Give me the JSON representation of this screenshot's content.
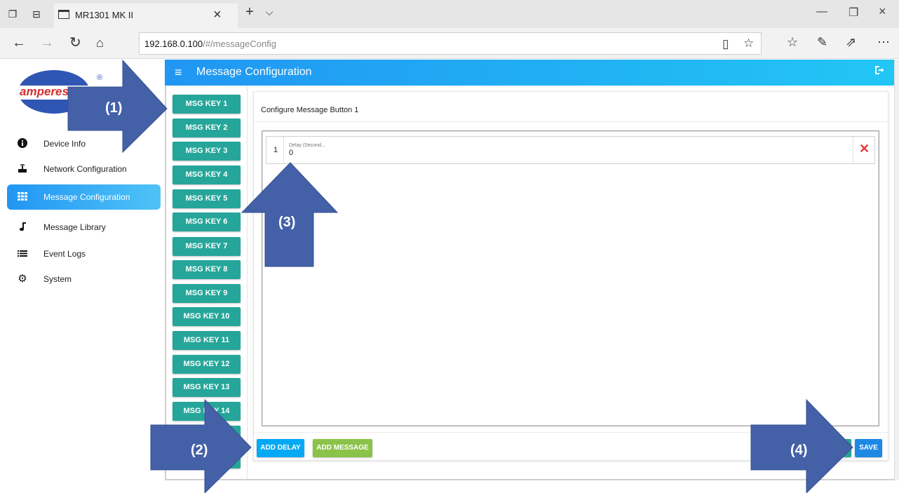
{
  "browser": {
    "tab_title": "MR1301 MK II",
    "new_tab_icon": "plus-icon",
    "tab_list_icon": "chevron-down-icon",
    "address_host": "192.168.0.100",
    "address_path": "/#/messageConfig",
    "window_controls": [
      "minimize-icon",
      "restore-icon",
      "close-icon"
    ]
  },
  "sidebar": {
    "logo_text": "amperes",
    "logo_reg": "®",
    "items": [
      {
        "label": "Device Info",
        "icon": "info-icon"
      },
      {
        "label": "Network Configuration",
        "icon": "router-icon"
      },
      {
        "label": "Message Configuration",
        "icon": "grid-icon",
        "active": true
      },
      {
        "label": "Message Library",
        "icon": "music-note-icon"
      },
      {
        "label": "Event Logs",
        "icon": "list-icon"
      },
      {
        "label": "System",
        "icon": "gear-icon"
      }
    ]
  },
  "header": {
    "title": "Message Configuration",
    "logout_icon": "logout-icon"
  },
  "message_keys": [
    "MSG KEY 1",
    "MSG KEY 2",
    "MSG KEY 3",
    "MSG KEY 4",
    "MSG KEY 5",
    "MSG KEY 6",
    "MSG KEY 7",
    "MSG KEY 8",
    "MSG KEY 9",
    "MSG KEY 10",
    "MSG KEY 11",
    "MSG KEY 12",
    "MSG KEY 13",
    "MSG KEY 14"
  ],
  "config": {
    "title": "Configure Message Button 1",
    "rows": [
      {
        "index": "1",
        "field_label": "Delay (Second...",
        "value": "0"
      }
    ],
    "add_delay_label": "ADD DELAY",
    "add_message_label": "ADD MESSAGE",
    "save_label": "SAVE"
  },
  "annotations": [
    "(1)",
    "(2)",
    "(3)",
    "(4)"
  ],
  "colors": {
    "header_gradient_start": "#2196f3",
    "key_button": "#26a69a",
    "add_delay": "#03a9f4",
    "add_message": "#8bc34a",
    "save": "#1e88e5",
    "annotation_arrow": "#4461a8",
    "delete": "#e53935"
  }
}
